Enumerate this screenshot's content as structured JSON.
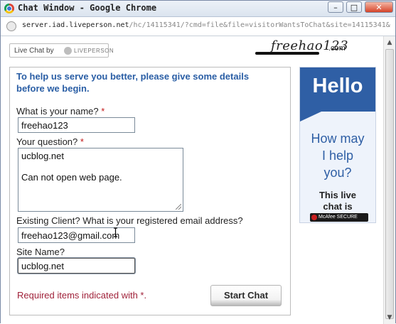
{
  "window": {
    "title": "Chat Window - Google Chrome",
    "controls": {
      "minimize": "–",
      "maximize": "□",
      "close": "✕"
    }
  },
  "address_bar": {
    "host": "server.iad.liveperson.net",
    "path": "/hc/14115341/?cmd=file&file=visitorWantsToChat&site=14115341&"
  },
  "branding": {
    "liveperson_prefix": "Live Chat by",
    "liveperson_name": "LIVEPERSON",
    "site_logo_main": "freehao123",
    "site_logo_suffix": ".com"
  },
  "form": {
    "intro": "To help us serve you better, please give some details before we begin.",
    "required_marker": "*",
    "name_label": "What is your name?",
    "name_value": "freehao123",
    "question_label": "Your question?",
    "question_lines": [
      "ucblog.net",
      "",
      "Can not open web page."
    ],
    "email_label": "Existing Client? What is your registered email address?",
    "email_value": "freehao123@gmail.com",
    "site_label": "Site Name?",
    "site_value": "ucblog.net",
    "required_note": "Required items indicated with *.",
    "start_button": "Start Chat"
  },
  "ad": {
    "hello": "Hello",
    "question_lines": [
      "How may",
      "I help",
      "you?"
    ],
    "live_lines": [
      "This live",
      "chat is"
    ],
    "badge": "McAfee SECURE"
  },
  "colors": {
    "intro_text": "#2a5ea5",
    "required_text": "#a0223a",
    "ad_blue": "#2f5fa5"
  }
}
